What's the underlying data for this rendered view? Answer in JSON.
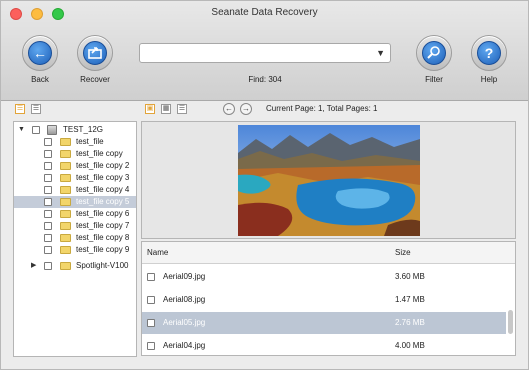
{
  "app": {
    "title": "Seanate Data Recovery"
  },
  "toolbar": {
    "back_label": "Back",
    "recover_label": "Recover",
    "filter_label": "Filter",
    "help_label": "Help",
    "find_text": "Find: 304",
    "search_value": ""
  },
  "subbar": {
    "page_info": "Current Page: 1, Total Pages: 1"
  },
  "tree": {
    "root": {
      "label": "TEST_12G",
      "icon": "drive-icon"
    },
    "items": [
      {
        "label": "test_file"
      },
      {
        "label": "test_file copy"
      },
      {
        "label": "test_file copy 2"
      },
      {
        "label": "test_file copy 3"
      },
      {
        "label": "test_file copy 4"
      },
      {
        "label": "test_file copy 5"
      },
      {
        "label": "test_file copy 6"
      },
      {
        "label": "test_file copy 7"
      },
      {
        "label": "test_file copy 8"
      },
      {
        "label": "test_file copy 9"
      },
      {
        "label": "Spotlight-V100"
      }
    ],
    "selected_index": 5
  },
  "file_list": {
    "columns": {
      "name": "Name",
      "size": "Size"
    },
    "rows": [
      {
        "name": "Aerial09.jpg",
        "size": "3.60 MB"
      },
      {
        "name": "Aerial08.jpg",
        "size": "1.47 MB"
      },
      {
        "name": "Aerial05.jpg",
        "size": "2.76 MB"
      },
      {
        "name": "Aerial04.jpg",
        "size": "4.00 MB"
      }
    ],
    "selected_index": 2
  },
  "colors": {
    "accent_blue": "#1d5fb8",
    "selection": "#c4ccd9",
    "folder": "#f2d56a"
  }
}
